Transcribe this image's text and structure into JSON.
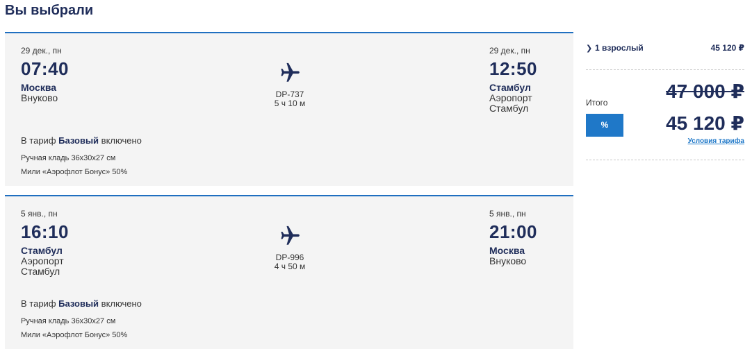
{
  "page": {
    "title": "Вы выбрали"
  },
  "flights": [
    {
      "departure": {
        "date": "29 дек., пн",
        "time": "07:40",
        "city": "Москва",
        "airport": "Внуково"
      },
      "flight_number": "DP-737",
      "duration": "5 ч 10 м",
      "arrival": {
        "date": "29 дек., пн",
        "time": "12:50",
        "city": "Стамбул",
        "airport": "Аэропорт Стамбул"
      },
      "tariff": {
        "prefix": "В тариф",
        "name": "Базовый",
        "suffix": "включено",
        "items": [
          "Ручная кладь 36х30х27 см",
          "Мили «Аэрофлот Бонус» 50%"
        ]
      }
    },
    {
      "departure": {
        "date": "5 янв., пн",
        "time": "16:10",
        "city": "Стамбул",
        "airport": "Аэропорт Стамбул"
      },
      "flight_number": "DP-996",
      "duration": "4 ч 50 м",
      "arrival": {
        "date": "5 янв., пн",
        "time": "21:00",
        "city": "Москва",
        "airport": "Внуково"
      },
      "tariff": {
        "prefix": "В тариф",
        "name": "Базовый",
        "suffix": "включено",
        "items": [
          "Ручная кладь 36х30х27 см",
          "Мили «Аэрофлот Бонус» 50%"
        ]
      }
    }
  ],
  "summary": {
    "passenger_label": "1 взрослый",
    "passenger_price": "45 120 ₽",
    "total_label": "Итого",
    "old_price": "47 000 ₽",
    "discount_label": "%",
    "new_price": "45 120 ₽",
    "terms_link": "Условия тарифа"
  },
  "icons": {
    "plane": "airplane-icon",
    "chevron": "chevron-right-icon"
  },
  "colors": {
    "accent": "#1f78c8",
    "text": "#1f2d5a",
    "card_bg": "#f4f4f4",
    "card_border": "#1f6fc0"
  }
}
